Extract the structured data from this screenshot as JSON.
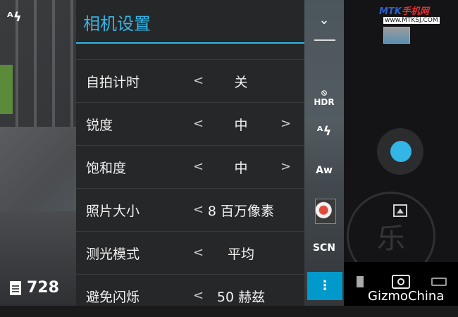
{
  "panel": {
    "title": "相机设置"
  },
  "settings": [
    {
      "label": "自拍计时",
      "value": "关",
      "has_left": true,
      "has_right": false
    },
    {
      "label": "锐度",
      "value": "中",
      "has_left": true,
      "has_right": true
    },
    {
      "label": "饱和度",
      "value": "中",
      "has_left": true,
      "has_right": true
    },
    {
      "label": "照片大小",
      "value": "8 百万像素",
      "has_left": true,
      "has_right": false
    },
    {
      "label": "测光模式",
      "value": "平均",
      "has_left": true,
      "has_right": false
    },
    {
      "label": "避免闪烁",
      "value": "50 赫兹",
      "has_left": true,
      "has_right": false
    }
  ],
  "arrows": {
    "left": "<",
    "right": ">"
  },
  "sidebar": {
    "chevron": "⌄",
    "hdr": "HDR",
    "flash": "ᴬϟ",
    "awb": "Aw",
    "scn": "SCN",
    "menu": "⋮"
  },
  "top_flash": "ᴬϟ",
  "counter": {
    "count": "728"
  },
  "logo": {
    "text_blue": "MTK",
    "text_red": "手机网",
    "url": "www.MTKSJ.COM"
  },
  "watermark": {
    "glyph": "乐"
  },
  "footer": {
    "gizmo": "GizmoChina"
  },
  "colors": {
    "accent": "#33b5e5",
    "menu_button": "#0099cc"
  },
  "icons": {
    "flash": "flash-auto-icon",
    "hdr": "hdr-off-icon",
    "awb": "white-balance-auto-icon",
    "scene": "scene-mode-icon",
    "menu": "overflow-menu-icon",
    "shutter": "shutter-button-icon",
    "photo_mode": "photo-mode-icon",
    "camera": "camera-icon",
    "panorama": "panorama-icon"
  }
}
